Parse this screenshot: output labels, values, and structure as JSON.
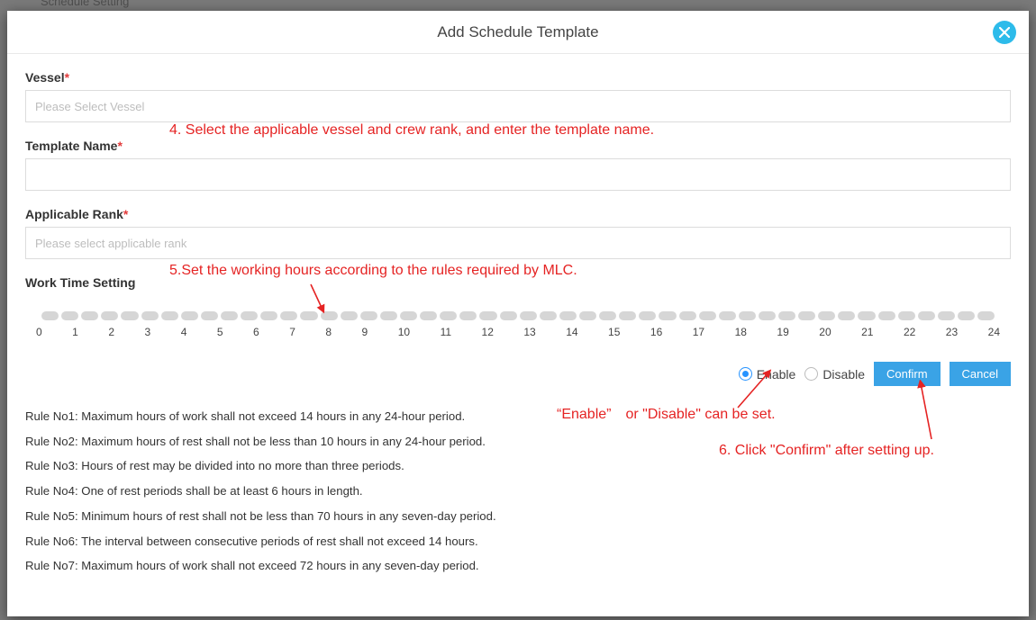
{
  "background_text": "Schedule Setting",
  "modal": {
    "title": "Add Schedule Template"
  },
  "fields": {
    "vessel_label": "Vessel",
    "vessel_placeholder": "Please Select Vessel",
    "template_label": "Template Name",
    "template_value": "",
    "rank_label": "Applicable Rank",
    "rank_placeholder": "Please select applicable rank",
    "worktime_label": "Work Time Setting"
  },
  "timeline": {
    "hours": [
      "0",
      "1",
      "2",
      "3",
      "4",
      "5",
      "6",
      "7",
      "8",
      "9",
      "10",
      "11",
      "12",
      "13",
      "14",
      "15",
      "16",
      "17",
      "18",
      "19",
      "20",
      "21",
      "22",
      "23",
      "24"
    ]
  },
  "toolbar": {
    "enable_label": "Enable",
    "disable_label": "Disable",
    "confirm_label": "Confirm",
    "cancel_label": "Cancel",
    "selected": "enable"
  },
  "rules": [
    "Rule No1: Maximum hours of work shall not exceed 14 hours in any 24-hour period.",
    "Rule No2: Maximum hours of rest shall not be less than 10 hours in any 24-hour period.",
    "Rule No3: Hours of rest may be divided into no more than three periods.",
    "Rule No4: One of rest periods shall be at least 6 hours in length.",
    "Rule No5: Minimum hours of rest shall not be less than 70 hours in any seven-day period.",
    "Rule No6: The interval between consecutive periods of rest shall not exceed 14 hours.",
    "Rule No7: Maximum hours of work shall not exceed 72 hours in any seven-day period."
  ],
  "annotations": {
    "step4": "4. Select the applicable vessel and crew rank, and enter the template name.",
    "step5": "5.Set the working hours according to the rules required by MLC.",
    "enable_note": "“Enable” or \"Disable\" can be set.",
    "step6": "6. Click \"Confirm\" after setting up."
  }
}
